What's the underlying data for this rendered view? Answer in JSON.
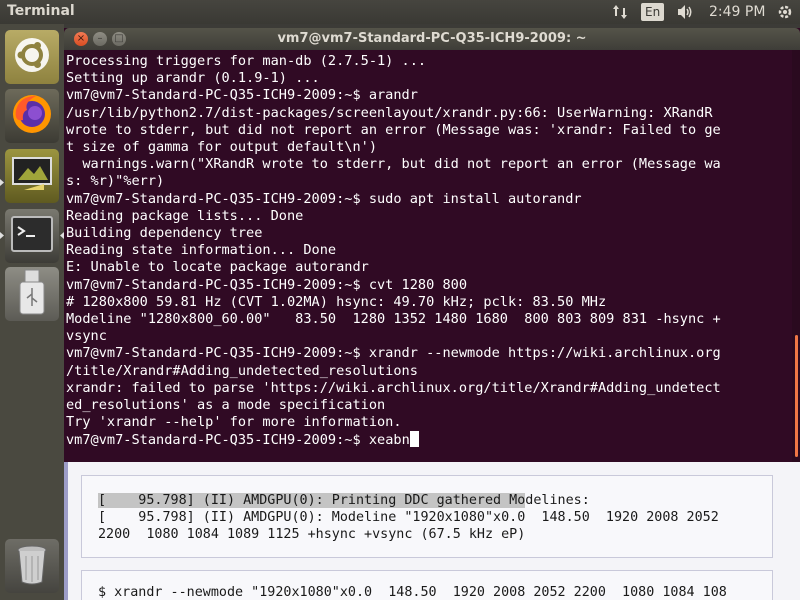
{
  "top_panel": {
    "app_name": "Terminal",
    "network_icon": "network-arrows-icon",
    "keyboard_layout": "En",
    "volume_icon": "volume-icon",
    "clock": "2:49 PM",
    "power_icon": "gear-power-icon"
  },
  "launcher": {
    "items": [
      {
        "name": "dash",
        "icon": "ubuntu-logo-icon"
      },
      {
        "name": "firefox",
        "icon": "firefox-icon"
      },
      {
        "name": "display-settings",
        "icon": "display-settings-icon"
      },
      {
        "name": "terminal",
        "icon": "terminal-icon"
      },
      {
        "name": "usb",
        "icon": "usb-drive-icon"
      },
      {
        "name": "trash",
        "icon": "trash-icon"
      }
    ]
  },
  "terminal": {
    "title": "vm7@vm7-Standard-PC-Q35-ICH9-2009: ~",
    "lines": [
      "Processing triggers for man-db (2.7.5-1) ...",
      "Setting up arandr (0.1.9-1) ...",
      "vm7@vm7-Standard-PC-Q35-ICH9-2009:~$ arandr",
      "/usr/lib/python2.7/dist-packages/screenlayout/xrandr.py:66: UserWarning: XRandR",
      "wrote to stderr, but did not report an error (Message was: 'xrandr: Failed to ge",
      "t size of gamma for output default\\n')",
      "  warnings.warn(\"XRandR wrote to stderr, but did not report an error (Message wa",
      "s: %r)\"%err)",
      "vm7@vm7-Standard-PC-Q35-ICH9-2009:~$ sudo apt install autorandr",
      "Reading package lists... Done",
      "Building dependency tree",
      "Reading state information... Done",
      "E: Unable to locate package autorandr",
      "vm7@vm7-Standard-PC-Q35-ICH9-2009:~$ cvt 1280 800",
      "# 1280x800 59.81 Hz (CVT 1.02MA) hsync: 49.70 kHz; pclk: 83.50 MHz",
      "Modeline \"1280x800_60.00\"   83.50  1280 1352 1480 1680  800 803 809 831 -hsync +",
      "vsync",
      "vm7@vm7-Standard-PC-Q35-ICH9-2009:~$ xrandr --newmode https://wiki.archlinux.org",
      "/title/Xrandr#Adding_undetected_resolutions",
      "xrandr: failed to parse 'https://wiki.archlinux.org/title/Xrandr#Adding_undetect",
      "ed_resolutions' as a mode specification",
      "Try 'xrandr --help' for more information."
    ],
    "prompt": "vm7@vm7-Standard-PC-Q35-ICH9-2009:~$ ",
    "current_input": "xeabn"
  },
  "browser": {
    "code_block_1": {
      "line1_highlighted": "[    95.798] (II) AMDGPU(0): Printing DDC gathered Mo",
      "line1_rest": "delines:",
      "line2": "[    95.798] (II) AMDGPU(0): Modeline \"1920x1080\"x0.0  148.50  1920 2008 2052",
      "line3": "2200  1080 1084 1089 1125 +hsync +vsync (67.5 kHz eP)"
    },
    "code_block_2": {
      "line1": "$ xrandr --newmode \"1920x1080\"x0.0  148.50  1920 2008 2052 2200  1080 1084 108"
    }
  }
}
